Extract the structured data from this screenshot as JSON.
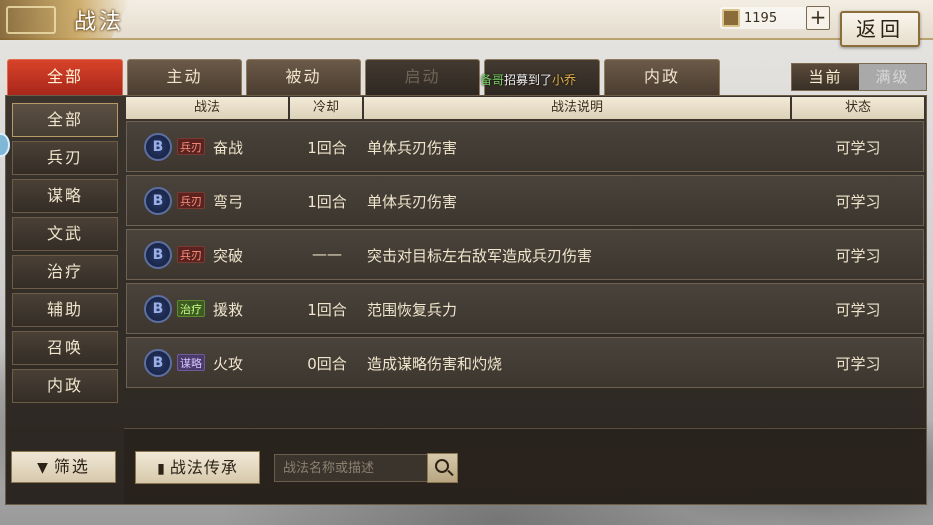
{
  "header": {
    "title": "战法",
    "currency_value": "1195",
    "plus_label": "+",
    "back_label": "返回"
  },
  "tabs": [
    {
      "label": "全部",
      "state": "active"
    },
    {
      "label": "主动",
      "state": "normal"
    },
    {
      "label": "被动",
      "state": "normal"
    },
    {
      "label": "启动",
      "state": "disabled"
    },
    {
      "label": "",
      "state": "disabled"
    },
    {
      "label": "内政",
      "state": "normal"
    }
  ],
  "notice": {
    "prefix": "备哥",
    "middle": "招募到了",
    "name": "小乔"
  },
  "level_toggle": {
    "current": "当前",
    "max": "满级"
  },
  "sidebar": {
    "items": [
      "全部",
      "兵刃",
      "谋略",
      "文武",
      "治疗",
      "辅助",
      "召唤",
      "内政"
    ],
    "filter_label": "筛选"
  },
  "table": {
    "headers": [
      "战法",
      "冷却",
      "战法说明",
      "状态"
    ],
    "rows": [
      {
        "grade": "B",
        "tag": "兵刃",
        "tag_color": "red",
        "name": "奋战",
        "cd": "1回合",
        "desc": "单体兵刃伤害",
        "status": "可学习"
      },
      {
        "grade": "B",
        "tag": "兵刃",
        "tag_color": "red",
        "name": "弯弓",
        "cd": "1回合",
        "desc": "单体兵刃伤害",
        "status": "可学习"
      },
      {
        "grade": "B",
        "tag": "兵刃",
        "tag_color": "red",
        "name": "突破",
        "cd": "——",
        "desc": "突击对目标左右敌军造成兵刃伤害",
        "status": "可学习"
      },
      {
        "grade": "B",
        "tag": "治疗",
        "tag_color": "green",
        "name": "援救",
        "cd": "1回合",
        "desc": "范围恢复兵力",
        "status": "可学习"
      },
      {
        "grade": "B",
        "tag": "谋略",
        "tag_color": "purple",
        "name": "火攻",
        "cd": "0回合",
        "desc": "造成谋略伤害和灼烧",
        "status": "可学习"
      }
    ]
  },
  "bottom": {
    "inherit_label": "战法传承",
    "search_placeholder": "战法名称或描述"
  }
}
